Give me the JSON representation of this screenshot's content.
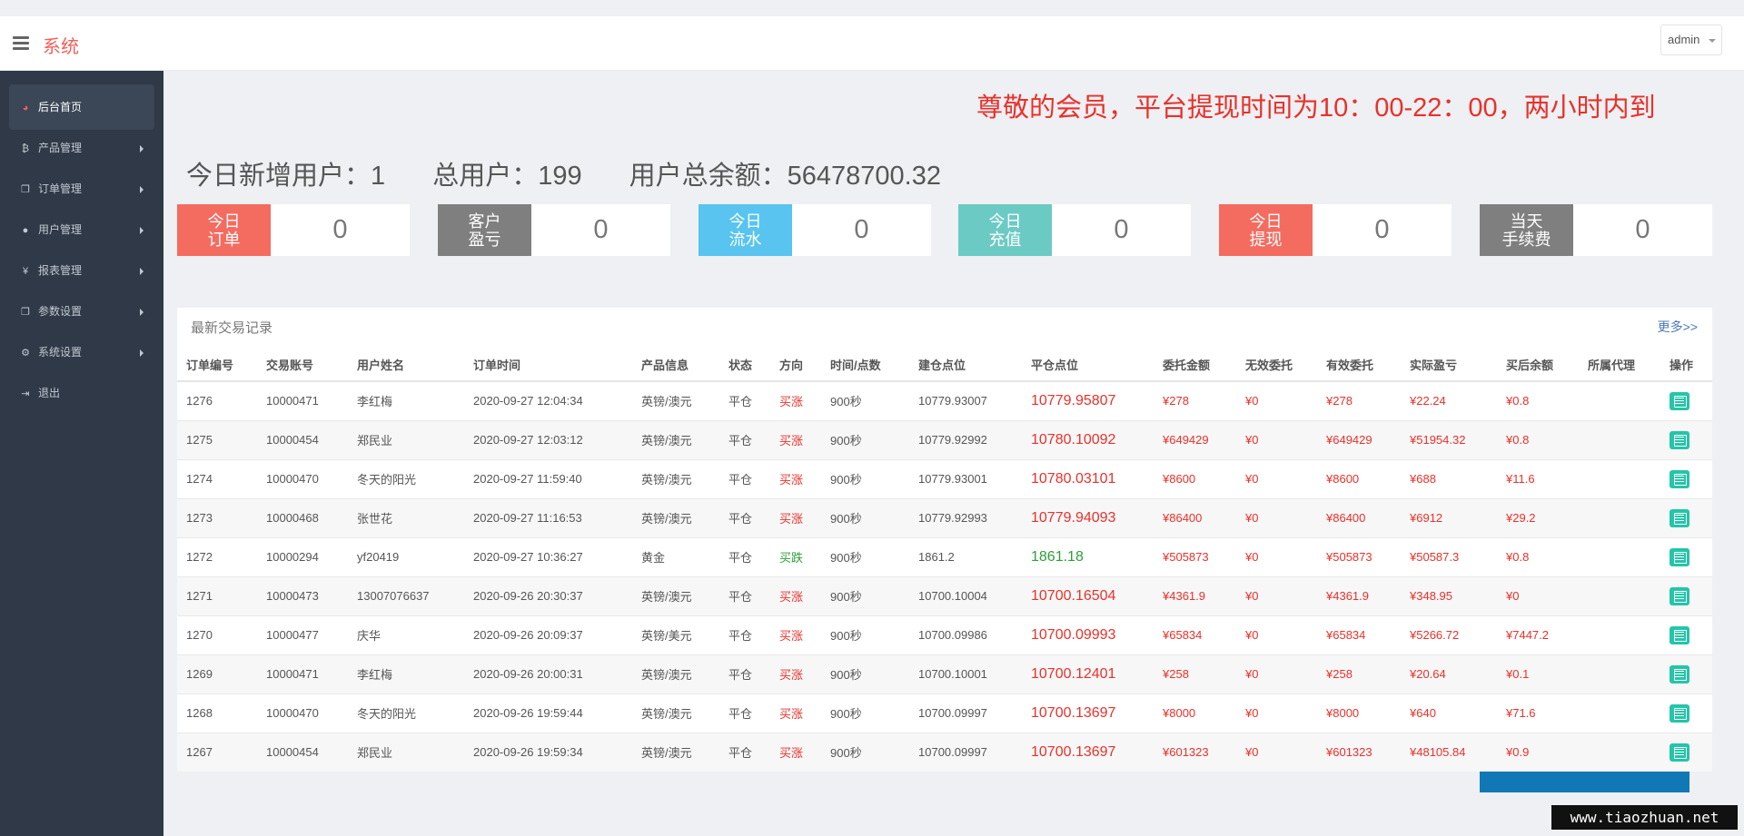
{
  "header": {
    "brand": "系统",
    "user": "admin"
  },
  "sidebar": {
    "items": [
      {
        "label": "后台首页",
        "icon": "dashboard-icon",
        "glyph": "◕"
      },
      {
        "label": "产品管理",
        "icon": "bitcoin-icon",
        "glyph": "₿"
      },
      {
        "label": "订单管理",
        "icon": "copy-icon",
        "glyph": "❐"
      },
      {
        "label": "用户管理",
        "icon": "user-icon",
        "glyph": "●"
      },
      {
        "label": "报表管理",
        "icon": "yen-icon",
        "glyph": "¥"
      },
      {
        "label": "参数设置",
        "icon": "copy-icon",
        "glyph": "❐"
      },
      {
        "label": "系统设置",
        "icon": "gears-icon",
        "glyph": "⚙"
      },
      {
        "label": "退出",
        "icon": "sign-out-icon",
        "glyph": "⇥"
      }
    ]
  },
  "notice": "尊敬的会员，平台提现时间为10：00-22：00，两小时内到",
  "stats": {
    "new_users": "今日新增用户：1",
    "total_users": "总用户：199",
    "total_balance": "用户总余额：56478700.32"
  },
  "cards": [
    {
      "label": "今日\n订单",
      "value": "0",
      "color": "#f46c60"
    },
    {
      "label": "客户\n盈亏",
      "value": "0",
      "color": "#7f7f7f"
    },
    {
      "label": "今日\n流水",
      "value": "0",
      "color": "#58c4ef"
    },
    {
      "label": "今日\n充值",
      "value": "0",
      "color": "#6ccac4"
    },
    {
      "label": "今日\n提现",
      "value": "0",
      "color": "#f46c60"
    },
    {
      "label": "当天\n手续费",
      "value": "0",
      "color": "#7f7f7f"
    }
  ],
  "panel": {
    "title": "最新交易记录",
    "more": "更多>>",
    "columns": [
      "订单编号",
      "交易账号",
      "用户姓名",
      "订单时间",
      "产品信息",
      "状态",
      "方向",
      "时间/点数",
      "建仓点位",
      "平仓点位",
      "委托金额",
      "无效委托",
      "有效委托",
      "实际盈亏",
      "买后余额",
      "所属代理",
      "操作"
    ],
    "rows": [
      [
        "1276",
        "10000471",
        "李红梅",
        "2020-09-27 12:04:34",
        "英镑/澳元",
        "平仓",
        "买涨",
        "900秒",
        "10779.93007",
        "10779.95807",
        "¥278",
        "¥0",
        "¥278",
        "¥22.24",
        "¥0.8",
        ""
      ],
      [
        "1275",
        "10000454",
        "郑民业",
        "2020-09-27 12:03:12",
        "英镑/澳元",
        "平仓",
        "买涨",
        "900秒",
        "10779.92992",
        "10780.10092",
        "¥649429",
        "¥0",
        "¥649429",
        "¥51954.32",
        "¥0.8",
        ""
      ],
      [
        "1274",
        "10000470",
        "冬天的阳光",
        "2020-09-27 11:59:40",
        "英镑/澳元",
        "平仓",
        "买涨",
        "900秒",
        "10779.93001",
        "10780.03101",
        "¥8600",
        "¥0",
        "¥8600",
        "¥688",
        "¥11.6",
        ""
      ],
      [
        "1273",
        "10000468",
        "张世花",
        "2020-09-27 11:16:53",
        "英镑/澳元",
        "平仓",
        "买涨",
        "900秒",
        "10779.92993",
        "10779.94093",
        "¥86400",
        "¥0",
        "¥86400",
        "¥6912",
        "¥29.2",
        ""
      ],
      [
        "1272",
        "10000294",
        "yf20419",
        "2020-09-27 10:36:27",
        "黄金",
        "平仓",
        "买跌",
        "900秒",
        "1861.2",
        "1861.18",
        "¥505873",
        "¥0",
        "¥505873",
        "¥50587.3",
        "¥0.8",
        ""
      ],
      [
        "1271",
        "10000473",
        "13007076637",
        "2020-09-26 20:30:37",
        "英镑/澳元",
        "平仓",
        "买涨",
        "900秒",
        "10700.10004",
        "10700.16504",
        "¥4361.9",
        "¥0",
        "¥4361.9",
        "¥348.95",
        "¥0",
        ""
      ],
      [
        "1270",
        "10000477",
        "庆华",
        "2020-09-26 20:09:37",
        "英镑/美元",
        "平仓",
        "买涨",
        "900秒",
        "10700.09986",
        "10700.09993",
        "¥65834",
        "¥0",
        "¥65834",
        "¥5266.72",
        "¥7447.2",
        ""
      ],
      [
        "1269",
        "10000471",
        "李红梅",
        "2020-09-26 20:00:31",
        "英镑/澳元",
        "平仓",
        "买涨",
        "900秒",
        "10700.10001",
        "10700.12401",
        "¥258",
        "¥0",
        "¥258",
        "¥20.64",
        "¥0.1",
        ""
      ],
      [
        "1268",
        "10000470",
        "冬天的阳光",
        "2020-09-26 19:59:44",
        "英镑/澳元",
        "平仓",
        "买涨",
        "900秒",
        "10700.09997",
        "10700.13697",
        "¥8000",
        "¥0",
        "¥8000",
        "¥640",
        "¥71.6",
        ""
      ],
      [
        "1267",
        "10000454",
        "郑民业",
        "2020-09-26 19:59:34",
        "英镑/澳元",
        "平仓",
        "买涨",
        "900秒",
        "10700.09997",
        "10700.13697",
        "¥601323",
        "¥0",
        "¥601323",
        "¥48105.84",
        "¥0.9",
        ""
      ]
    ]
  },
  "watermark": "www.tiaozhuan.net"
}
